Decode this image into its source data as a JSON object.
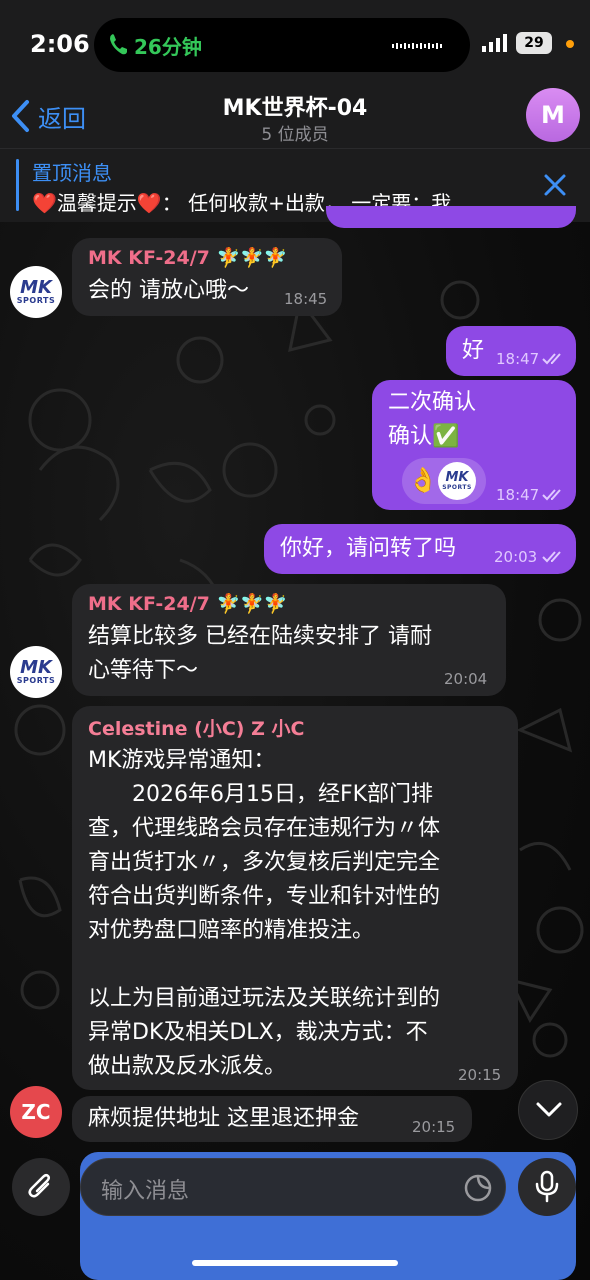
{
  "status_bar": {
    "time": "2:06",
    "call_duration": "26分钟",
    "battery": "29"
  },
  "header": {
    "back_label": "返回",
    "title": "MK世界杯-04",
    "member_count": "5 位成员",
    "avatar_letter": "M"
  },
  "pinned": {
    "title": "置顶消息",
    "text": "❤️温馨提示❤️： 任何收款+出款， 一定要：我..."
  },
  "messages": [
    {
      "sender": "MK KF-24/7 🧚🧚🧚",
      "text": "会的 请放心哦～",
      "time": "18:45"
    },
    {
      "text": "好",
      "time": "18:47"
    },
    {
      "line1": "二次确认",
      "line2": "确认✅",
      "time": "18:47",
      "reaction_emoji": "👌"
    },
    {
      "text": "你好，请问转了吗",
      "time": "20:03"
    },
    {
      "sender": "MK KF-24/7 🧚🧚🧚",
      "line1": "结算比较多 已经在陆续安排了 请耐",
      "line2": "心等待下～",
      "time": "20:04"
    },
    {
      "sender": "Celestine (小C) Z 小C",
      "lines": [
        "MK游戏异常通知：",
        "　　2026年6月15日，经FK部门排",
        "查，代理线路会员存在违规行为〃体",
        "育出货打水〃，多次复核后判定完全",
        "符合出货判断条件，专业和针对性的",
        "对优势盘口赔率的精准投注。",
        "",
        "以上为目前通过玩法及关联统计到的",
        "异常DK及相关DLX，裁决方式：不",
        "做出款及反水派发。"
      ],
      "time": "20:15"
    },
    {
      "text": "麻烦提供地址 这里退还押金",
      "time": "20:15",
      "avatar": "ZC"
    }
  ],
  "avatar_logo": {
    "main": "MK",
    "sub": "SPORTS"
  },
  "input": {
    "placeholder": "输入消息"
  },
  "colors": {
    "accent": "#3d8ff5",
    "outgoing": "#8e49e5",
    "incoming": "#262628",
    "call_green": "#34c759"
  }
}
